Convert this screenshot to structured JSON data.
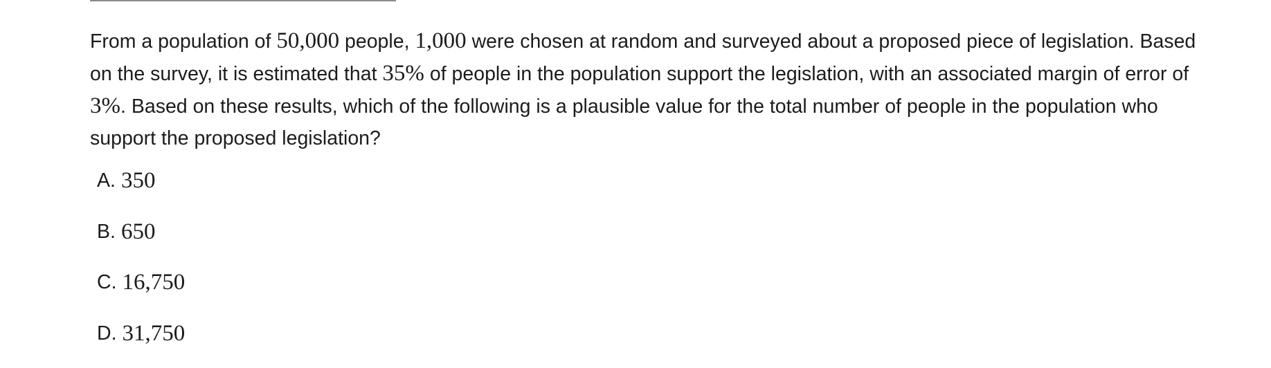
{
  "question": {
    "t1": "From a population of ",
    "m1": "50,000",
    "t2": " people, ",
    "m2": "1,000",
    "t3": " were chosen at random and surveyed about a proposed piece of legislation. Based on the survey, it is estimated that ",
    "m3": "35%",
    "t4": " of people in the population support the legislation, with an associated margin of error of ",
    "m4": "3%",
    "t5": ". Based on these results, which of the following is a plausible value for the total number of people in the population who support the proposed legislation?"
  },
  "choices": [
    {
      "letter": "A.",
      "value": "350"
    },
    {
      "letter": "B.",
      "value": "650"
    },
    {
      "letter": "C.",
      "value": "16,750"
    },
    {
      "letter": "D.",
      "value": "31,750"
    }
  ]
}
